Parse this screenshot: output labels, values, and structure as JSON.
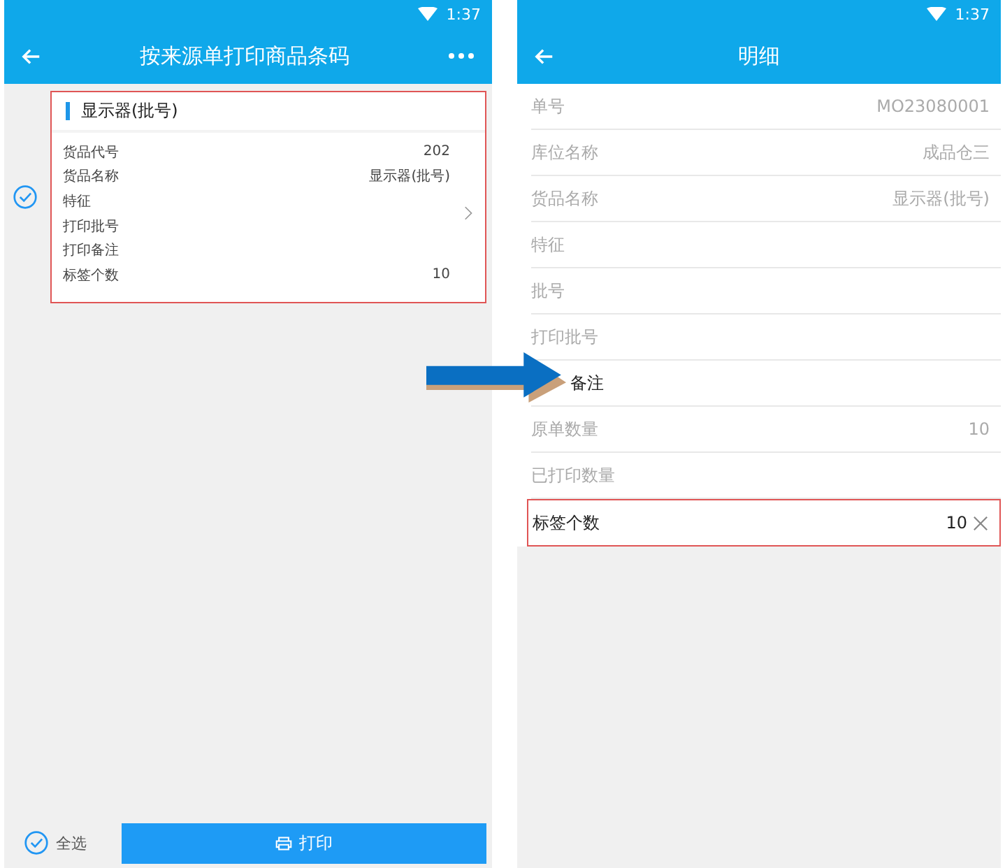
{
  "left_screen": {
    "status_time": "1:37",
    "title": "按来源单打印商品条码",
    "card": {
      "title": "显示器(批号)",
      "selected": true,
      "fields": [
        {
          "label": "货品代号",
          "value": "202"
        },
        {
          "label": "货品名称",
          "value": "显示器(批号)"
        },
        {
          "label": "特征"
        },
        {
          "label": "打印批号"
        },
        {
          "label": "打印备注"
        },
        {
          "label": "标签个数",
          "value": "10"
        }
      ]
    },
    "footer": {
      "select_all": {
        "label": "全选",
        "checked": true
      },
      "print_button": "打印"
    }
  },
  "right_screen": {
    "status_time": "1:37",
    "title": "明细",
    "rows": [
      {
        "label": "单号",
        "value": "MO23080001",
        "kind": "readonly"
      },
      {
        "label": "库位名称",
        "value": "成品仓三",
        "kind": "readonly"
      },
      {
        "label": "货品名称",
        "value": "显示器(批号)",
        "kind": "readonly"
      },
      {
        "label": "特征",
        "kind": "readonly"
      },
      {
        "label": "批号",
        "kind": "readonly"
      },
      {
        "label": "打印批号",
        "kind": "readonly"
      },
      {
        "label": "备注",
        "kind": "editable",
        "covered": true
      },
      {
        "label": "原单数量",
        "value": "10",
        "kind": "readonly"
      },
      {
        "label": "已打印数量",
        "kind": "readonly"
      },
      {
        "label": "标签个数",
        "value": "10",
        "kind": "input"
      }
    ]
  }
}
